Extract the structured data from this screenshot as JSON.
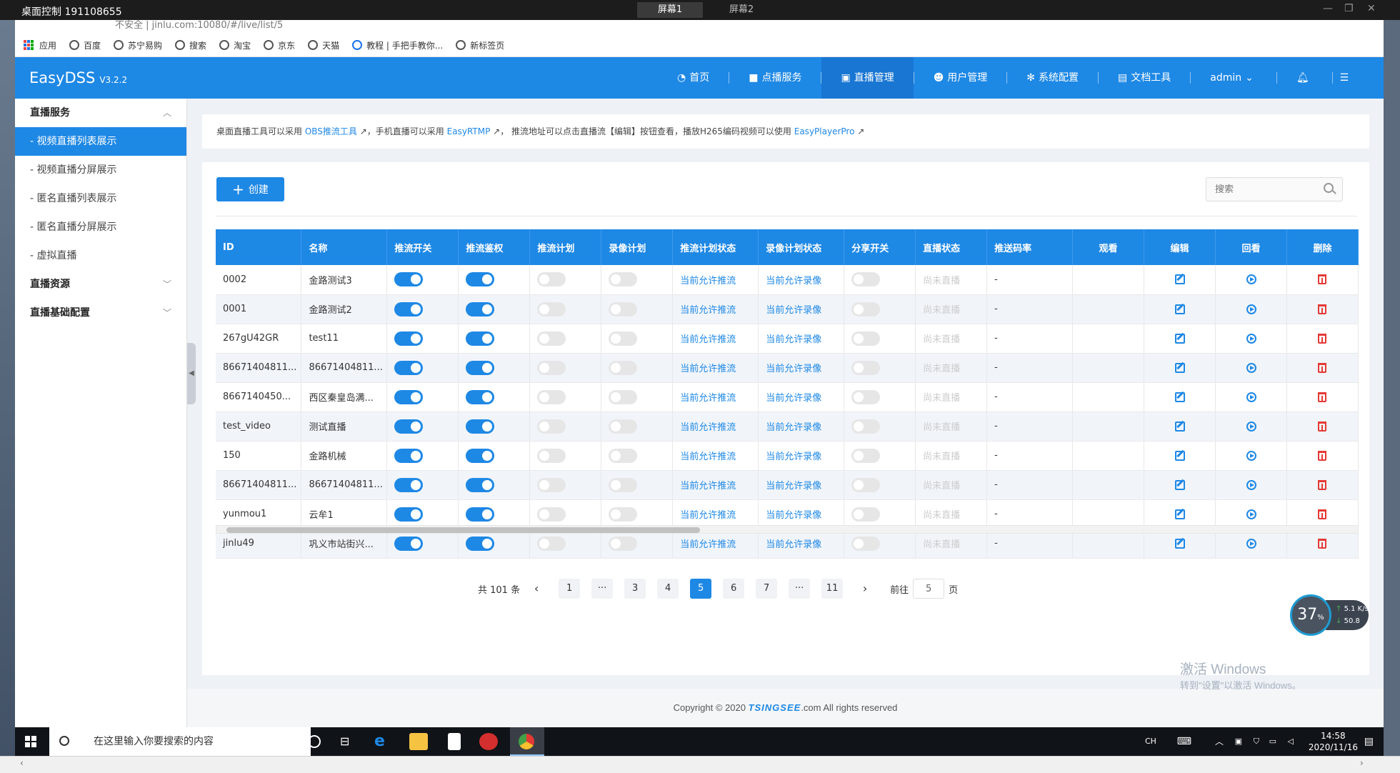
{
  "remote_desktop": {
    "title": "桌面控制 191108655",
    "tabs": [
      "屏幕1",
      "屏幕2"
    ]
  },
  "browser": {
    "address_partial": "不安全 | jinlu.com:10080/#/live/list/5",
    "bookmarks": [
      "应用",
      "百度",
      "苏宁易购",
      "搜索",
      "淘宝",
      "京东",
      "天猫",
      "教程 | 手把手教你...",
      "新标签页"
    ]
  },
  "header": {
    "brand": "EasyDSS",
    "version": "V3.2.2",
    "nav": [
      {
        "label": "首页",
        "icon": "dashboard-icon"
      },
      {
        "label": "点播服务",
        "icon": "video-camera-icon"
      },
      {
        "label": "直播管理",
        "icon": "live-icon"
      },
      {
        "label": "用户管理",
        "icon": "user-icon"
      },
      {
        "label": "系统配置",
        "icon": "gear-icon"
      },
      {
        "label": "文档工具",
        "icon": "document-icon"
      },
      {
        "label": "admin",
        "icon": "chevron-down-icon"
      }
    ]
  },
  "sidebar": {
    "group1": "直播服务",
    "items": [
      "- 视频直播列表展示",
      "- 视频直播分屏展示",
      "- 匿名直播列表展示",
      "- 匿名直播分屏展示",
      "- 虚拟直播"
    ],
    "group2": "直播资源",
    "group3": "直播基础配置"
  },
  "notice": {
    "t1": "桌面直播工具可以采用 ",
    "link1": "OBS推流工具",
    "t2": "，手机直播可以采用 ",
    "link2": "EasyRTMP",
    "t3": "， 推流地址可以点击直播流【编辑】按钮查看，播放H265编码视频可以使用 ",
    "link3": "EasyPlayerPro"
  },
  "toolbar": {
    "create_label": "创建",
    "search_placeholder": "搜索"
  },
  "table": {
    "headers": [
      "ID",
      "名称",
      "推流开关",
      "推流鉴权",
      "推流计划",
      "录像计划",
      "推流计划状态",
      "录像计划状态",
      "分享开关",
      "直播状态",
      "推送码率",
      "观看",
      "编辑",
      "回看",
      "删除"
    ],
    "rows": [
      {
        "id": "0002",
        "name": "金路测试3",
        "push": true,
        "auth": true,
        "plan": false,
        "rec": false,
        "plan_status": "当前允许推流",
        "rec_status": "当前允许录像",
        "share": false,
        "live": "尚未直播",
        "rate": "-"
      },
      {
        "id": "0001",
        "name": "金路测试2",
        "push": true,
        "auth": true,
        "plan": false,
        "rec": false,
        "plan_status": "当前允许推流",
        "rec_status": "当前允许录像",
        "share": false,
        "live": "尚未直播",
        "rate": "-"
      },
      {
        "id": "267gU42GR",
        "name": "test11",
        "push": true,
        "auth": true,
        "plan": false,
        "rec": false,
        "plan_status": "当前允许推流",
        "rec_status": "当前允许录像",
        "share": false,
        "live": "尚未直播",
        "rate": "-"
      },
      {
        "id": "86671404811...",
        "name": "86671404811...",
        "push": true,
        "auth": true,
        "plan": false,
        "rec": false,
        "plan_status": "当前允许推流",
        "rec_status": "当前允许录像",
        "share": false,
        "live": "尚未直播",
        "rate": "-"
      },
      {
        "id": "8667140450...",
        "name": "西区秦皇岛满...",
        "push": true,
        "auth": true,
        "plan": false,
        "rec": false,
        "plan_status": "当前允许推流",
        "rec_status": "当前允许录像",
        "share": false,
        "live": "尚未直播",
        "rate": "-"
      },
      {
        "id": "test_video",
        "name": "测试直播",
        "push": true,
        "auth": true,
        "plan": false,
        "rec": false,
        "plan_status": "当前允许推流",
        "rec_status": "当前允许录像",
        "share": false,
        "live": "尚未直播",
        "rate": "-"
      },
      {
        "id": "150",
        "name": "金路机械",
        "push": true,
        "auth": true,
        "plan": false,
        "rec": false,
        "plan_status": "当前允许推流",
        "rec_status": "当前允许录像",
        "share": false,
        "live": "尚未直播",
        "rate": "-"
      },
      {
        "id": "86671404811...",
        "name": "86671404811...",
        "push": true,
        "auth": true,
        "plan": false,
        "rec": false,
        "plan_status": "当前允许推流",
        "rec_status": "当前允许录像",
        "share": false,
        "live": "尚未直播",
        "rate": "-"
      },
      {
        "id": "yunmou1",
        "name": "云牟1",
        "push": true,
        "auth": true,
        "plan": false,
        "rec": false,
        "plan_status": "当前允许推流",
        "rec_status": "当前允许录像",
        "share": false,
        "live": "尚未直播",
        "rate": "-"
      },
      {
        "id": "jinlu49",
        "name": "巩义市站街兴...",
        "push": true,
        "auth": true,
        "plan": false,
        "rec": false,
        "plan_status": "当前允许推流",
        "rec_status": "当前允许录像",
        "share": false,
        "live": "尚未直播",
        "rate": "-"
      }
    ]
  },
  "pagination": {
    "total": "共 101 条",
    "pages": [
      "1",
      "···",
      "3",
      "4",
      "5",
      "6",
      "7",
      "···",
      "11"
    ],
    "current": "5",
    "goto_prefix": "前往",
    "goto_value": "5",
    "goto_suffix": "页"
  },
  "footer": {
    "prefix": "Copyright © 2020 ",
    "brand": "TSINGSEE",
    "suffix": ".com All rights reserved"
  },
  "speed": {
    "percent": "37",
    "up": "5.1",
    "down": "50.8"
  },
  "watermark": {
    "line1": "激活 Windows",
    "line2": "转到\"设置\"以激活 Windows。"
  },
  "taskbar": {
    "search_placeholder": "在这里输入你要搜索的内容",
    "ime": "CH",
    "time": "14:58",
    "date": "2020/11/16"
  },
  "colors": {
    "accent": "#1e88e5",
    "danger": "#e53935"
  }
}
